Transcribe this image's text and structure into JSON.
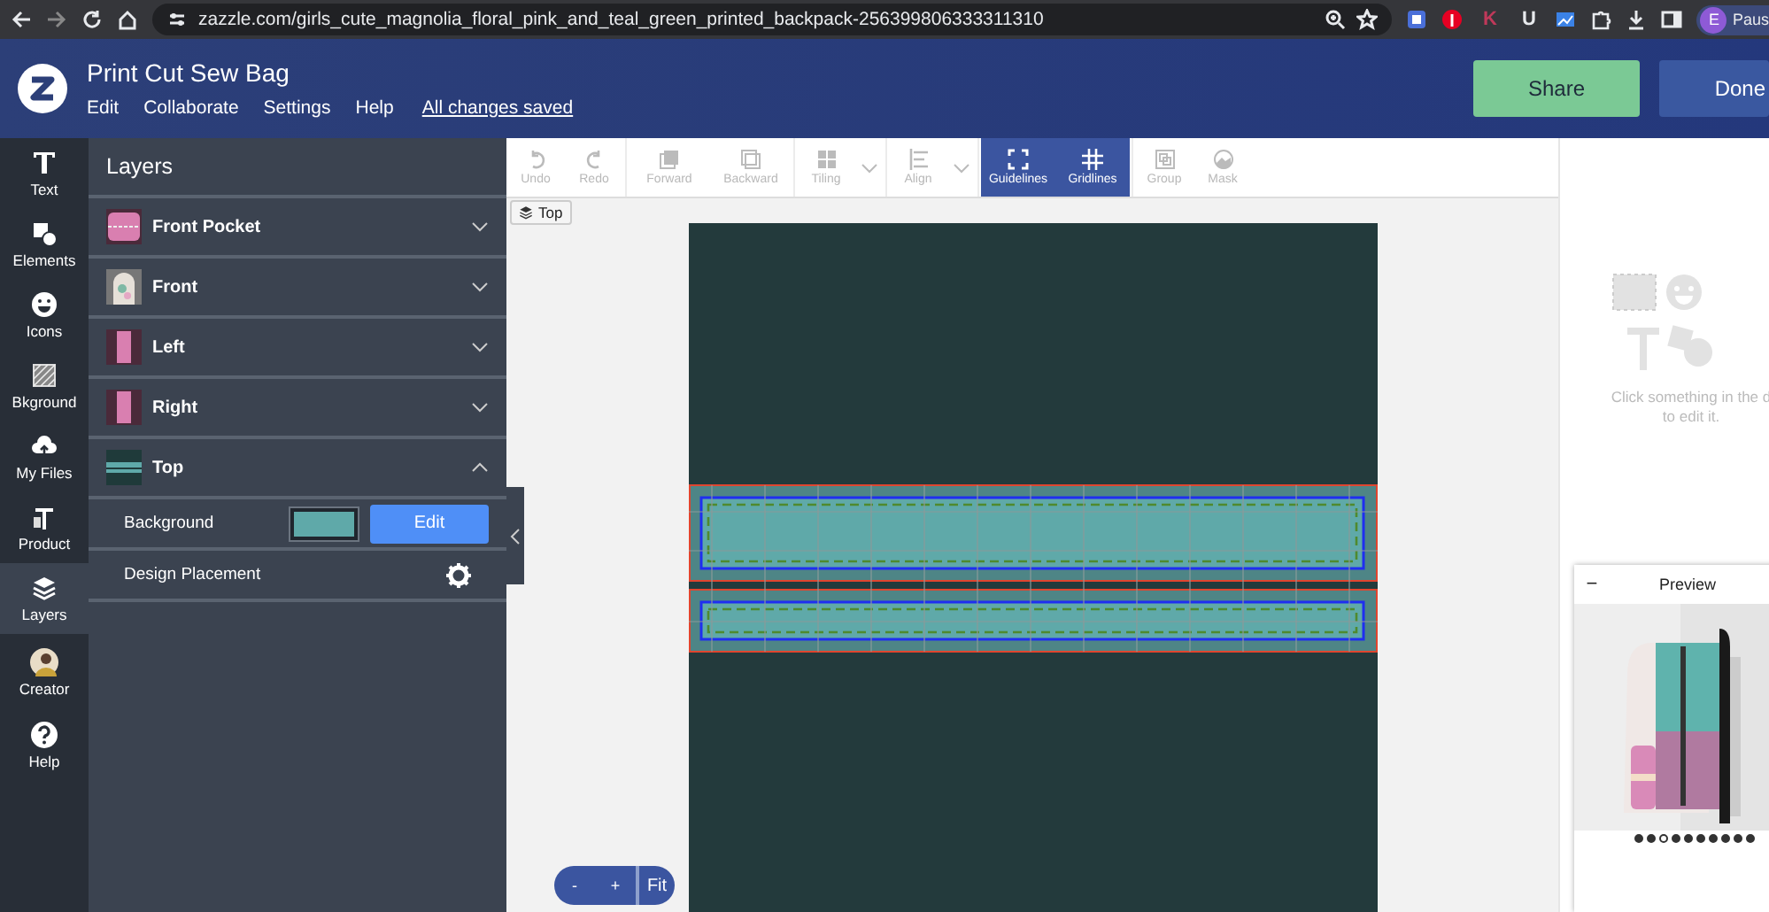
{
  "browser": {
    "url": "zazzle.com/girls_cute_magnolia_floral_pink_and_teal_green_printed_backpack-256399806333311310",
    "profile_initial": "E",
    "profile_name": "Paus",
    "extensions": [
      {
        "kind": "tile",
        "color": "#4a6fd8"
      },
      {
        "kind": "pin",
        "color": "#e60023"
      },
      {
        "kind": "letter",
        "label": "K",
        "color": "#c0395a"
      },
      {
        "kind": "letter",
        "label": "U",
        "color": "#e8eaed"
      },
      {
        "kind": "chart",
        "color": "#3b82e6"
      },
      {
        "kind": "puzzle",
        "color": "#e8eaed"
      }
    ]
  },
  "header": {
    "title": "Print Cut Sew Bag",
    "menu": [
      "Edit",
      "Collaborate",
      "Settings",
      "Help"
    ],
    "saved_status": "All changes saved",
    "buttons": [
      {
        "label": "Share",
        "kind": "primary"
      },
      {
        "label": "Done",
        "kind": "secondary"
      }
    ]
  },
  "rail": [
    {
      "label": "Text",
      "kind": "text",
      "selected": false
    },
    {
      "label": "Elements",
      "kind": "elements",
      "selected": false
    },
    {
      "label": "Icons",
      "kind": "icons",
      "selected": false
    },
    {
      "label": "Bkground",
      "kind": "background",
      "selected": false
    },
    {
      "label": "My Files",
      "kind": "files",
      "selected": false
    },
    {
      "label": "Product",
      "kind": "product",
      "selected": false
    },
    {
      "label": "Layers",
      "kind": "layers",
      "selected": true
    },
    {
      "label": "Creator",
      "kind": "creator",
      "selected": false
    },
    {
      "label": "Help",
      "kind": "help",
      "selected": false
    }
  ],
  "layers_panel": {
    "title": "Layers",
    "layers": [
      {
        "name": "Front Pocket",
        "kind": "pocket",
        "expanded": false
      },
      {
        "name": "Front",
        "kind": "front",
        "expanded": false
      },
      {
        "name": "Left",
        "kind": "side",
        "expanded": false
      },
      {
        "name": "Right",
        "kind": "side",
        "expanded": false
      },
      {
        "name": "Top",
        "kind": "top",
        "expanded": true
      }
    ],
    "options": [
      {
        "kind": "color",
        "label": "Background",
        "color": "#5fa9a9",
        "button": "Edit"
      },
      {
        "kind": "settings",
        "label": "Design Placement"
      }
    ]
  },
  "toolbar": [
    {
      "label": "Undo",
      "kind": "undo",
      "disabled": true,
      "selected": false
    },
    {
      "label": "Redo",
      "kind": "redo",
      "disabled": true,
      "selected": false
    },
    {
      "label": "Forward",
      "kind": "forward",
      "disabled": true,
      "selected": false
    },
    {
      "label": "Backward",
      "kind": "backward",
      "disabled": true,
      "selected": false
    },
    {
      "label": "Tiling",
      "kind": "tiling",
      "disabled": true,
      "selected": false,
      "dropdown": true
    },
    {
      "label": "Align",
      "kind": "align",
      "disabled": true,
      "selected": false,
      "dropdown": true
    },
    {
      "label": "Guidelines",
      "kind": "guidelines",
      "disabled": false,
      "selected": true
    },
    {
      "label": "Gridlines",
      "kind": "gridlines",
      "disabled": false,
      "selected": true
    },
    {
      "label": "Group",
      "kind": "group",
      "disabled": true,
      "selected": false
    },
    {
      "label": "Mask",
      "kind": "mask",
      "disabled": true,
      "selected": false
    }
  ],
  "canvas": {
    "view_label": "Top",
    "zoom": [
      "-",
      "+",
      "Fit"
    ]
  },
  "properties": {
    "hint_lines": [
      "Click something in the d",
      "to edit it."
    ]
  },
  "preview": {
    "collapse": "−",
    "title": "Preview",
    "dots": [
      {
        "selected": false
      },
      {
        "selected": false
      },
      {
        "selected": true
      },
      {
        "selected": false
      },
      {
        "selected": false
      },
      {
        "selected": false
      },
      {
        "selected": false
      },
      {
        "selected": false
      },
      {
        "selected": false
      },
      {
        "selected": false
      }
    ]
  }
}
